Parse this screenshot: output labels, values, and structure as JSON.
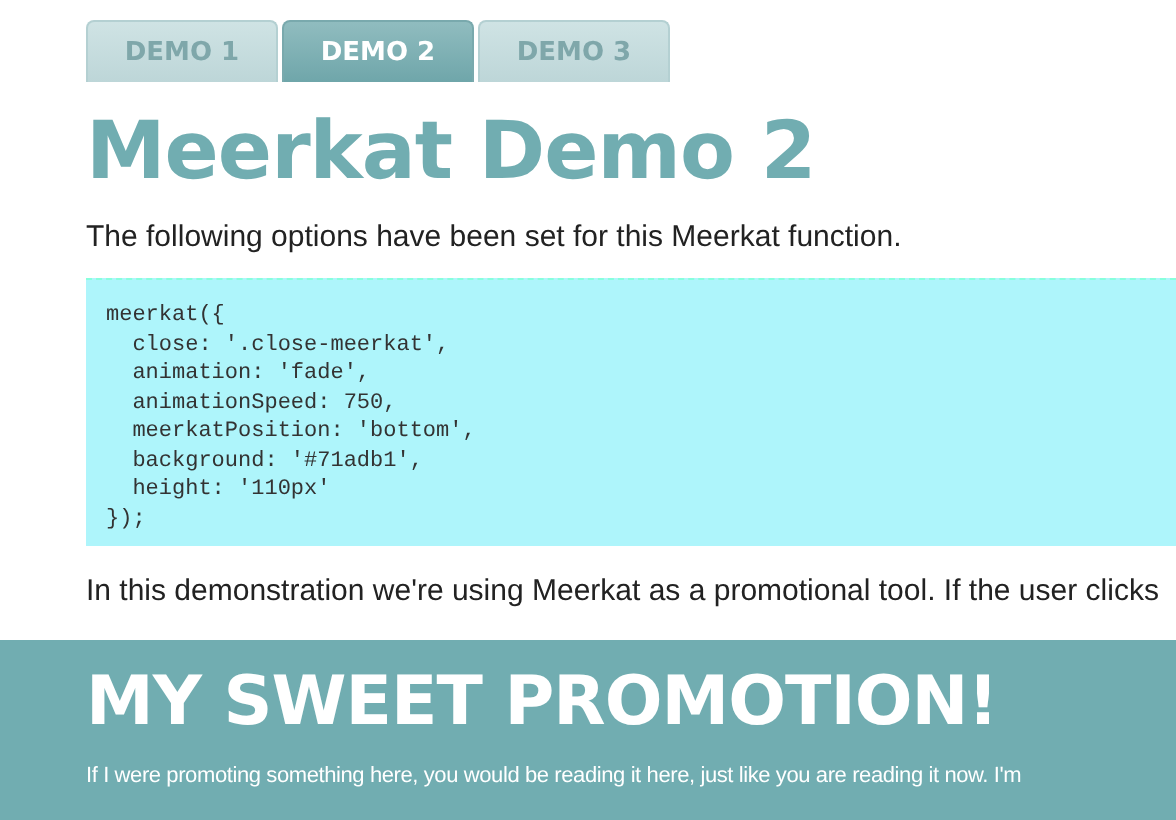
{
  "tabs": [
    {
      "label": "DEMO 1",
      "selected": false
    },
    {
      "label": "DEMO 2",
      "selected": true
    },
    {
      "label": "DEMO 3",
      "selected": false
    }
  ],
  "heading": "Meerkat Demo 2",
  "intro": "The following options have been set for this Meerkat function.",
  "code": [
    "meerkat({",
    "  close: '.close-meerkat',",
    "  animation: 'fade',",
    "  animationSpeed: 750,",
    "  meerkatPosition: 'bottom',",
    "  background: '#71adb1',",
    "  height: '110px'",
    "});"
  ],
  "paragraph": "In this demonstration we're using Meerkat as a promotional tool. If the user clicks",
  "promo": {
    "title": "MY SWEET PROMOTION!",
    "text": "If I were promoting something here, you would be reading it here, just like you are reading it now. I'm"
  }
}
